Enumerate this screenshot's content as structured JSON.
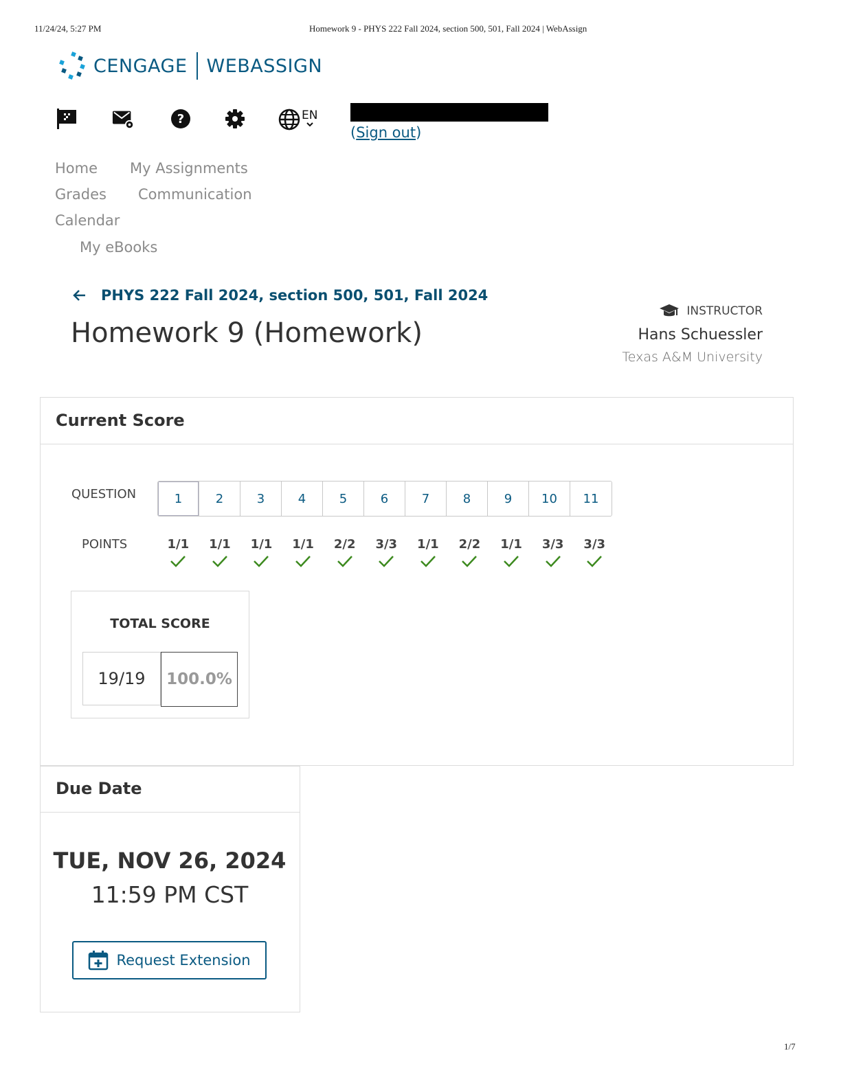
{
  "print_header": {
    "datetime": "11/24/24, 5:27 PM",
    "page_title": "Homework 9 - PHYS 222 Fall 2024, section 500, 501, Fall 2024 | WebAssign"
  },
  "brand": {
    "left": "CENGAGE",
    "right": "WEBASSIGN"
  },
  "toolbar": {
    "icons": [
      "flag-icon",
      "mail-settings-icon",
      "help-icon",
      "gear-icon",
      "globe-icon"
    ],
    "language": "EN",
    "sign_out_open": "(",
    "sign_out": "Sign out",
    "sign_out_close": ")"
  },
  "nav": {
    "home": "Home",
    "my_assignments": "My Assignments",
    "grades": "Grades",
    "communication": "Communication",
    "calendar": "Calendar",
    "my_ebooks": "My eBooks"
  },
  "breadcrumb": {
    "course": "PHYS 222 Fall 2024, section 500, 501, Fall 2024"
  },
  "title": "Homework 9 (Homework)",
  "instructor": {
    "label": "INSTRUCTOR",
    "name": "Hans Schuessler",
    "university": "Texas A&M University"
  },
  "score": {
    "heading": "Current Score",
    "question_label": "QUESTION",
    "points_label": "POINTS",
    "questions": [
      "1",
      "2",
      "3",
      "4",
      "5",
      "6",
      "7",
      "8",
      "9",
      "10",
      "11"
    ],
    "points": [
      "1/1",
      "1/1",
      "1/1",
      "1/1",
      "2/2",
      "3/3",
      "1/1",
      "2/2",
      "1/1",
      "3/3",
      "3/3"
    ],
    "total_label": "TOTAL SCORE",
    "total_fraction": "19/19",
    "total_percent": "100.0%",
    "check_color": "#3d8a1f"
  },
  "due": {
    "heading": "Due Date",
    "date": "TUE, NOV 26, 2024",
    "time": "11:59 PM CST",
    "button": "Request Extension"
  },
  "page_number": "1/7"
}
